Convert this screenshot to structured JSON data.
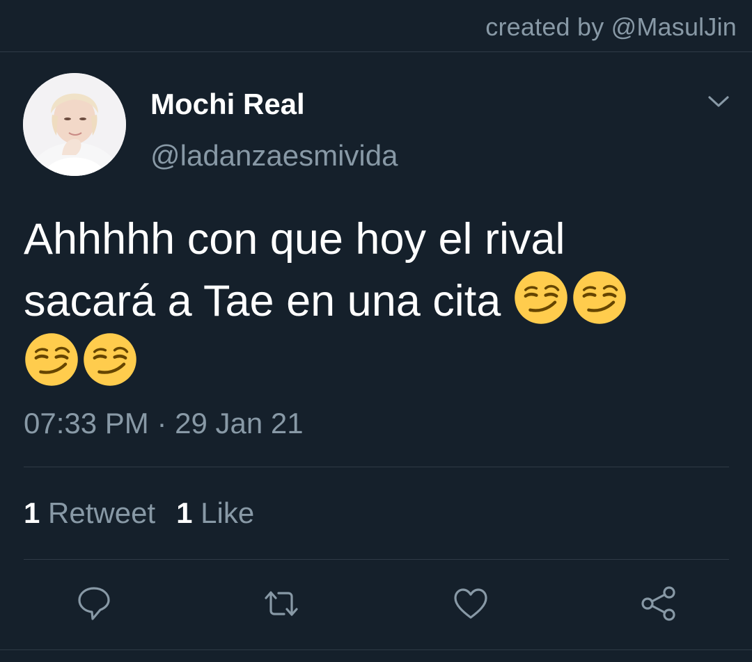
{
  "credit": "created by @MasulJin",
  "tweet": {
    "display_name": "Mochi Real",
    "handle": "@ladanzaesmivida",
    "text_line1": "Ahhhhh con que hoy el rival",
    "text_line2": "sacará a Tae en una cita",
    "emoji": [
      "smirking-face",
      "smirking-face",
      "smirking-face",
      "smirking-face"
    ],
    "timestamp": "07:33 PM · 29 Jan 21"
  },
  "stats": {
    "retweet_count": "1",
    "retweet_label": "Retweet",
    "like_count": "1",
    "like_label": "Like"
  },
  "actions": {
    "icons": [
      "reply-icon",
      "retweet-icon",
      "like-icon",
      "share-icon"
    ]
  },
  "colors": {
    "background": "#15202b",
    "primary_text": "#ffffff",
    "secondary_text": "#8899a6",
    "divider": "#2f3b47",
    "emoji": "#ffcc4d"
  }
}
